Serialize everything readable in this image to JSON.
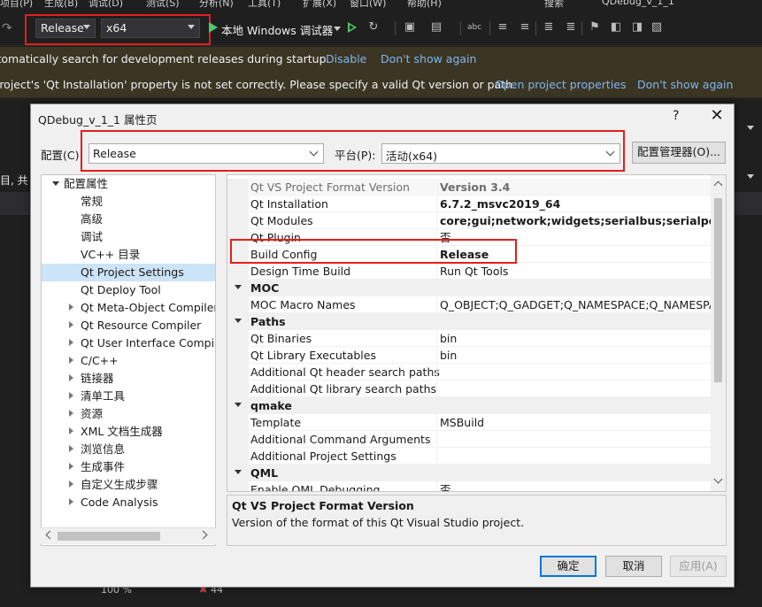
{
  "vs": {
    "menu": [
      "项目(P)",
      "生成(B)",
      "调试(D)",
      "测试(S)",
      "分析(N)",
      "工具(T)",
      "扩展(X)",
      "窗口(W)",
      "帮助(H)",
      "搜索",
      "QDebug_v_1_1"
    ],
    "toolbar": {
      "config_value": "Release",
      "platform_value": "x64",
      "run_label": "本地 Windows 调试器"
    },
    "infobar1": {
      "text": "Automatically search for development releases during startup.",
      "links": [
        "Disable",
        "Don't show again"
      ]
    },
    "infobar2": {
      "text": "Project's 'Qt Installation' property is not set correctly. Please specify a valid Qt version or path.",
      "links": [
        "Open project properties",
        "Don't show again"
      ]
    },
    "left_fragment": "目, 共",
    "status": {
      "zoom": "100 %",
      "errors": "44"
    }
  },
  "dialog": {
    "title": "QDebug_v_1_1 属性页",
    "help": "?",
    "close": "✕",
    "config_label": "配置(C):",
    "config_value": "Release",
    "platform_label": "平台(P):",
    "platform_value": "活动(x64)",
    "config_manager": "配置管理器(O)...",
    "tree": [
      {
        "label": "配置属性",
        "level": 0,
        "expander": "open"
      },
      {
        "label": "常规",
        "level": 1,
        "expander": "none"
      },
      {
        "label": "高级",
        "level": 1,
        "expander": "none"
      },
      {
        "label": "调试",
        "level": 1,
        "expander": "none"
      },
      {
        "label": "VC++ 目录",
        "level": 1,
        "expander": "none"
      },
      {
        "label": "Qt Project Settings",
        "level": 1,
        "expander": "none",
        "selected": true
      },
      {
        "label": "Qt Deploy Tool",
        "level": 1,
        "expander": "none"
      },
      {
        "label": "Qt Meta-Object Compiler",
        "level": 1,
        "expander": "closed"
      },
      {
        "label": "Qt Resource Compiler",
        "level": 1,
        "expander": "closed"
      },
      {
        "label": "Qt User Interface Compiler",
        "level": 1,
        "expander": "closed"
      },
      {
        "label": "C/C++",
        "level": 1,
        "expander": "closed"
      },
      {
        "label": "链接器",
        "level": 1,
        "expander": "closed"
      },
      {
        "label": "清单工具",
        "level": 1,
        "expander": "closed"
      },
      {
        "label": "资源",
        "level": 1,
        "expander": "closed"
      },
      {
        "label": "XML 文档生成器",
        "level": 1,
        "expander": "closed"
      },
      {
        "label": "浏览信息",
        "level": 1,
        "expander": "closed"
      },
      {
        "label": "生成事件",
        "level": 1,
        "expander": "closed"
      },
      {
        "label": "自定义生成步骤",
        "level": 1,
        "expander": "closed"
      },
      {
        "label": "Code Analysis",
        "level": 1,
        "expander": "closed"
      }
    ],
    "grid": [
      {
        "kind": "prop",
        "name": "Qt VS Project Format Version",
        "value": "Version 3.4",
        "dim": true,
        "bold": true
      },
      {
        "kind": "prop",
        "name": "Qt Installation",
        "value": "6.7.2_msvc2019_64",
        "bold": true
      },
      {
        "kind": "prop",
        "name": "Qt Modules",
        "value": "core;gui;network;widgets;serialbus;serialport",
        "bold": true
      },
      {
        "kind": "prop",
        "name": "Qt Plugin",
        "value": "否"
      },
      {
        "kind": "prop",
        "name": "Build Config",
        "value": "Release",
        "bold": true
      },
      {
        "kind": "prop",
        "name": "Design Time Build",
        "value": "Run Qt Tools"
      },
      {
        "kind": "cat",
        "name": "MOC"
      },
      {
        "kind": "prop",
        "name": "MOC Macro Names",
        "value": "Q_OBJECT;Q_GADGET;Q_NAMESPACE;Q_NAMESPACE_EXPORT"
      },
      {
        "kind": "cat",
        "name": "Paths"
      },
      {
        "kind": "prop",
        "name": "Qt Binaries",
        "value": "bin"
      },
      {
        "kind": "prop",
        "name": "Qt Library Executables",
        "value": "bin"
      },
      {
        "kind": "prop",
        "name": "Additional Qt header search paths",
        "value": ""
      },
      {
        "kind": "prop",
        "name": "Additional Qt library search paths",
        "value": ""
      },
      {
        "kind": "cat",
        "name": "qmake"
      },
      {
        "kind": "prop",
        "name": "Template",
        "value": "MSBuild"
      },
      {
        "kind": "prop",
        "name": "Additional Command Arguments",
        "value": ""
      },
      {
        "kind": "prop",
        "name": "Additional Project Settings",
        "value": ""
      },
      {
        "kind": "cat",
        "name": "QML"
      },
      {
        "kind": "prop",
        "name": "Enable QML Debugging",
        "value": "否"
      }
    ],
    "description": {
      "title": "Qt VS Project Format Version",
      "body": "Version of the format of this Qt Visual Studio project."
    },
    "buttons": {
      "ok": "确定",
      "cancel": "取消",
      "apply": "应用(A)"
    }
  },
  "colors": {
    "highlight": "#e51e1e",
    "link": "#7fb5f0",
    "infobar": "#3b3523",
    "selection": "#cce4f7",
    "accent": "#0078d7"
  }
}
